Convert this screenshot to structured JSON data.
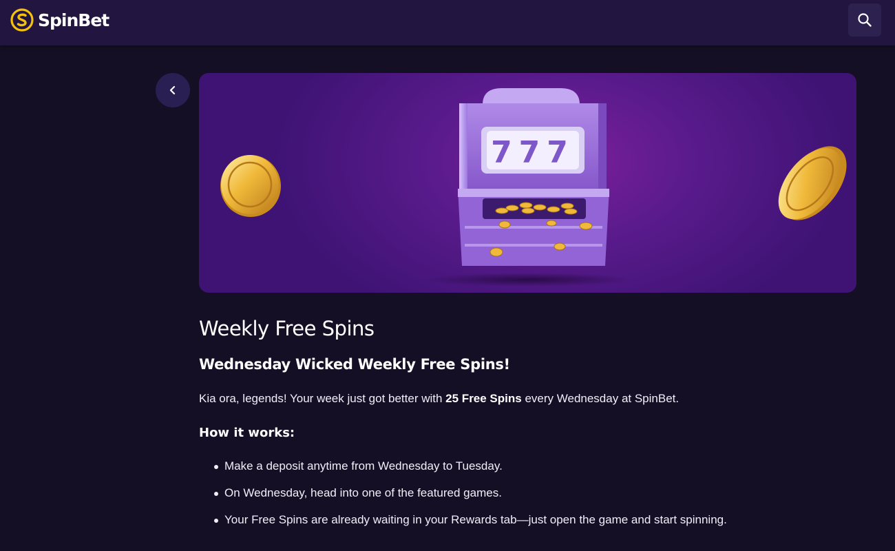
{
  "header": {
    "brand": "SpinBet",
    "logo_icon": "spinbet-logo-icon",
    "search_icon": "search-icon"
  },
  "hero": {
    "reel_symbols": "777",
    "colors": {
      "background": "#5a1b8c",
      "coin": "#e8b53a",
      "machine": "#9a6ad6"
    }
  },
  "navigation": {
    "back_icon": "chevron-left-icon"
  },
  "content": {
    "title": "Weekly Free Spins",
    "subtitle": "Wednesday Wicked Weekly Free Spins!",
    "intro": {
      "before": "Kia ora, legends! Your week just got better with ",
      "highlight": "25 Free Spins",
      "after": " every Wednesday at SpinBet."
    },
    "how_it_works_heading": "How it works:",
    "steps": [
      "Make a deposit anytime from Wednesday to Tuesday.",
      "On Wednesday, head into one of the featured games.",
      "Your Free Spins are already waiting in your Rewards tab—just open the game and start spinning."
    ]
  },
  "colors": {
    "page_background": "#150f26",
    "header_background": "#221640",
    "accent_yellow": "#f4c20d"
  }
}
